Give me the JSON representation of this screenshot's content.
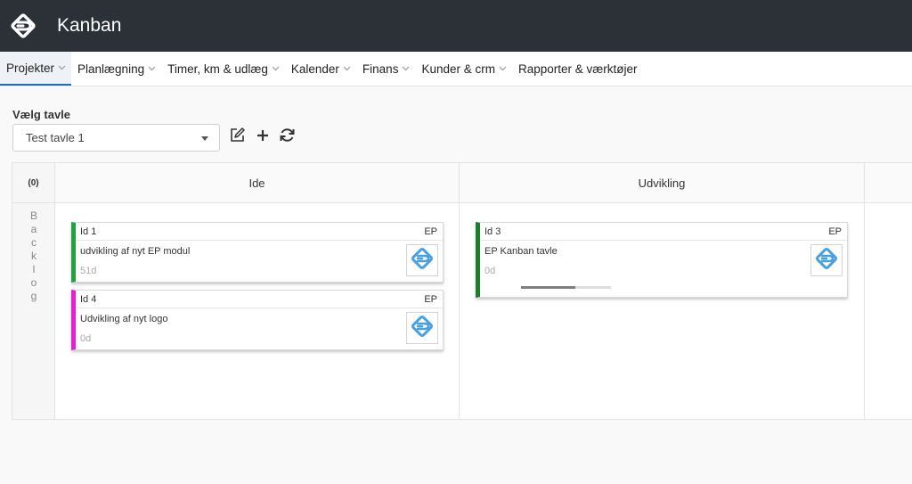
{
  "app": {
    "title": "Kanban"
  },
  "nav": {
    "items": [
      {
        "label": "Projekter",
        "active": true
      },
      {
        "label": "Planlægning",
        "active": false
      },
      {
        "label": "Timer, km & udlæg",
        "active": false
      },
      {
        "label": "Kalender",
        "active": false
      },
      {
        "label": "Finans",
        "active": false
      },
      {
        "label": "Kunder & crm",
        "active": false
      },
      {
        "label": "Rapporter & værktøjer",
        "active": false
      }
    ]
  },
  "board_select": {
    "label": "Vælg tavle",
    "value": "Test tavle 1"
  },
  "board": {
    "count": "(0)",
    "swimlane": "Backlog",
    "columns": [
      {
        "title": "Ide"
      },
      {
        "title": "Udvikling"
      }
    ],
    "cards": {
      "c1": {
        "id": "Id 1",
        "initials": "EP",
        "title": "udvikling af nyt EP modul",
        "age": "51d",
        "color": "#1fa33f"
      },
      "c4": {
        "id": "Id 4",
        "initials": "EP",
        "title": "Udvikling af nyt logo",
        "age": "0d",
        "color": "#e81ed6"
      },
      "c3": {
        "id": "Id 3",
        "initials": "EP",
        "title": "EP Kanban tavle",
        "age": "0d",
        "color": "#1d7d2c",
        "progress": 0.6
      }
    }
  },
  "colors": {
    "topbar": "#2b3137",
    "accent": "#1e6fb7",
    "avatar_logo": "#4a9fe0"
  }
}
